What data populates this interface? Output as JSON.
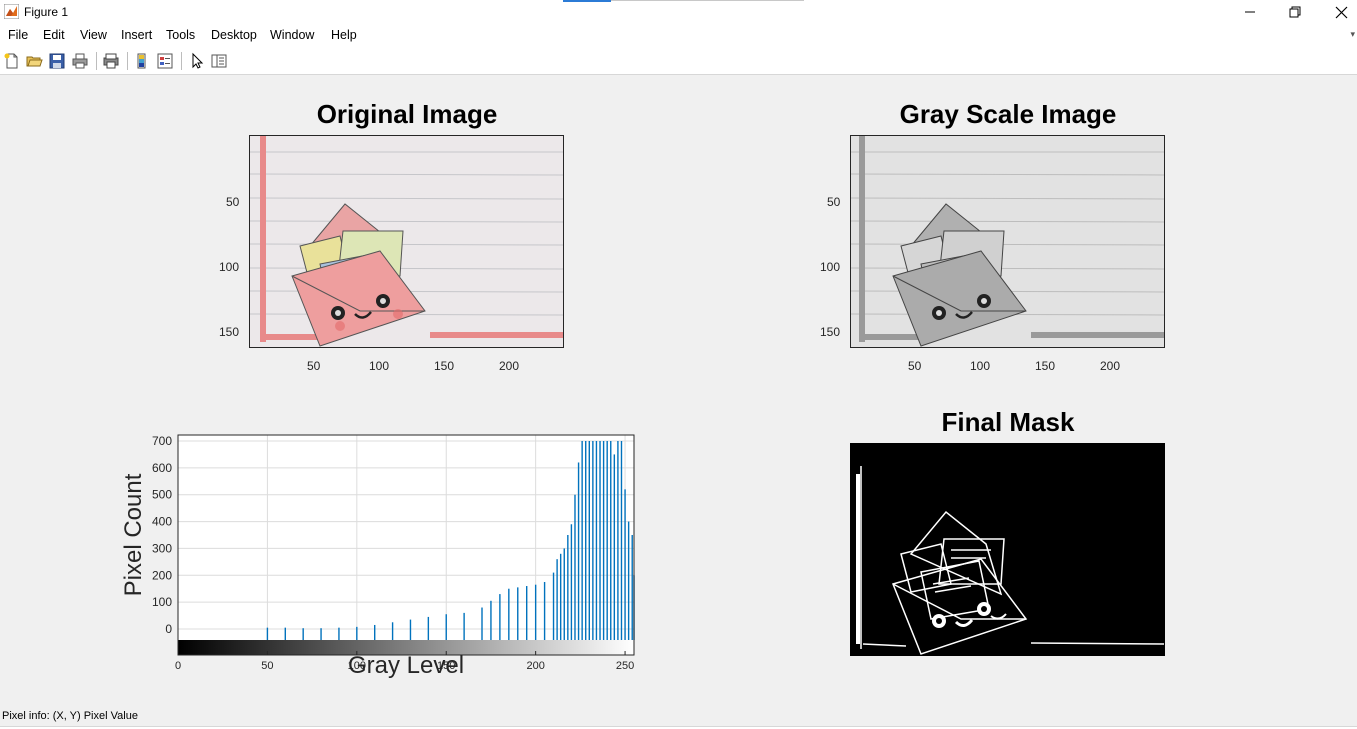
{
  "window": {
    "title": "Figure 1"
  },
  "menu": {
    "items": [
      "File",
      "Edit",
      "View",
      "Insert",
      "Tools",
      "Desktop",
      "Window",
      "Help"
    ]
  },
  "toolbar": {
    "icons": [
      "new-figure-icon",
      "open-file-icon",
      "save-icon",
      "print-icon",
      "print-preview-icon",
      "colorbar-icon",
      "legend-icon",
      "edit-plot-arrow-icon",
      "property-inspector-icon"
    ]
  },
  "panels": {
    "original": {
      "title": "Original Image",
      "y_ticks": [
        "50",
        "100",
        "150"
      ],
      "x_ticks": [
        "50",
        "100",
        "150",
        "200"
      ]
    },
    "gray": {
      "title": "Gray Scale Image",
      "y_ticks": [
        "50",
        "100",
        "150"
      ],
      "x_ticks": [
        "50",
        "100",
        "150",
        "200"
      ]
    },
    "mask": {
      "title": "Final Mask"
    },
    "histogram": {
      "ylabel": "Pixel Count",
      "xlabel": "Gray Level",
      "y_ticks": [
        "0",
        "100",
        "200",
        "300",
        "400",
        "500",
        "600",
        "700"
      ],
      "x_ticks": [
        "0",
        "50",
        "100",
        "150",
        "200",
        "250"
      ]
    }
  },
  "colors": {
    "bar": "#0072bd",
    "axis": "#262626",
    "grid": "#dcdcdc"
  },
  "status": {
    "text": "Pixel info: (X, Y)  Pixel Value"
  },
  "chart_data": {
    "type": "bar",
    "xlabel": "Gray Level",
    "ylabel": "Pixel Count",
    "xlim": [
      0,
      255
    ],
    "ylim": [
      0,
      700
    ],
    "grid": true,
    "x": [
      50,
      60,
      70,
      80,
      90,
      100,
      110,
      120,
      130,
      140,
      150,
      160,
      170,
      175,
      180,
      185,
      190,
      195,
      200,
      205,
      210,
      212,
      214,
      216,
      218,
      220,
      222,
      224,
      226,
      228,
      230,
      232,
      234,
      236,
      238,
      240,
      242,
      244,
      246,
      248,
      250,
      252,
      254,
      255
    ],
    "values": [
      5,
      5,
      3,
      3,
      5,
      8,
      15,
      25,
      35,
      45,
      55,
      60,
      80,
      105,
      130,
      150,
      155,
      160,
      165,
      175,
      210,
      260,
      280,
      300,
      350,
      390,
      500,
      620,
      700,
      700,
      700,
      700,
      700,
      700,
      700,
      700,
      700,
      650,
      700,
      700,
      520,
      400,
      350,
      200
    ]
  }
}
